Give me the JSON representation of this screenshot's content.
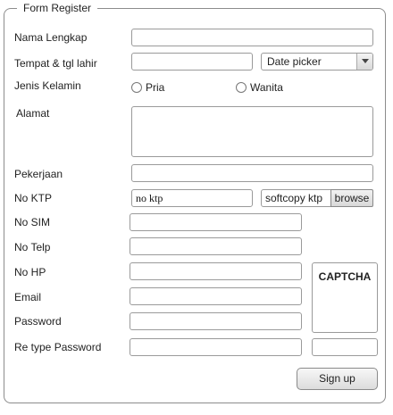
{
  "form": {
    "title": "Form Register",
    "labels": {
      "nama": "Nama Lengkap",
      "ttl": "Tempat & tgl lahir",
      "gender": "Jenis Kelamin",
      "alamat": "Alamat",
      "pekerjaan": "Pekerjaan",
      "ktp": "No KTP",
      "sim": "No SIM",
      "telp": "No Telp",
      "hp": "No HP",
      "email": "Email",
      "password": "Password",
      "retype": "Re type Password"
    },
    "date_picker": "Date picker",
    "gender_options": [
      "Pria",
      "Wanita"
    ],
    "ktp_value": "no ktp",
    "ktp_softcopy": "softcopy ktp",
    "browse_label": "browse",
    "captcha_label": "CAPTCHA",
    "signup_label": "Sign up"
  }
}
